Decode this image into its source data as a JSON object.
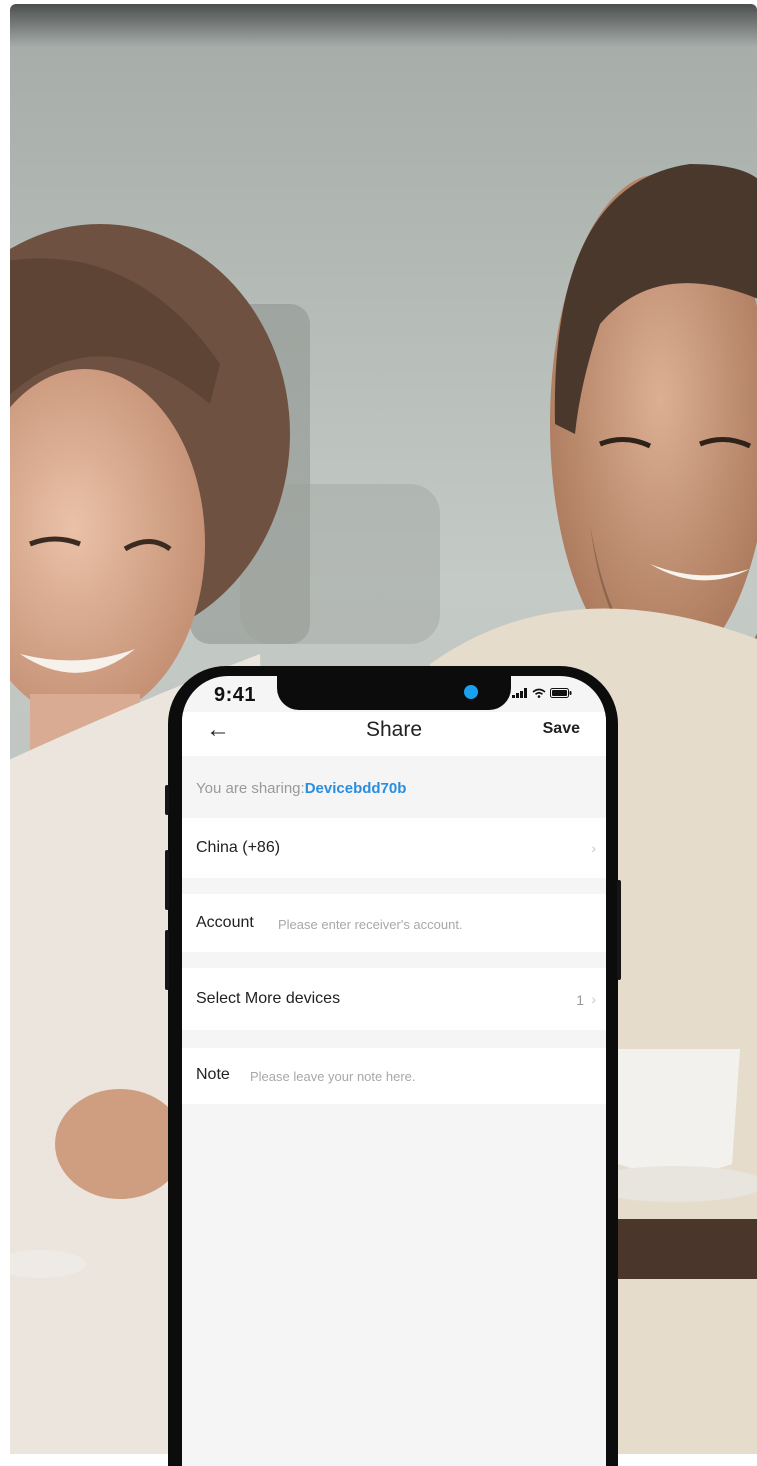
{
  "status_bar": {
    "time": "9:41"
  },
  "nav": {
    "title": "Share",
    "save_label": "Save"
  },
  "sharing": {
    "prefix": "You are sharing:",
    "device": "Devicebdd70b"
  },
  "region": {
    "label": "China (+86)"
  },
  "account": {
    "label": "Account",
    "placeholder": "Please enter receiver's account."
  },
  "devices": {
    "label": "Select More devices",
    "count": "1"
  },
  "note": {
    "label": "Note",
    "placeholder": "Please leave your note here."
  },
  "colors": {
    "accent": "#2a8ee0",
    "camera_dot": "#1aa0f0"
  },
  "icons": {
    "back": "arrow-left-icon",
    "chevron": "chevron-right-icon",
    "signal": "signal-icon",
    "wifi": "wifi-icon",
    "battery": "battery-icon"
  }
}
